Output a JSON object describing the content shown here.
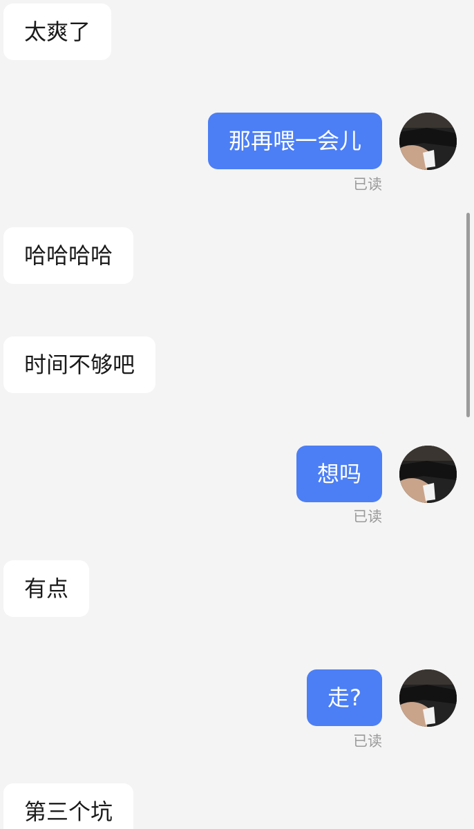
{
  "messages": [
    {
      "side": "in",
      "text": "太爽了"
    },
    {
      "side": "out",
      "text": "那再喂一会儿",
      "read": "已读"
    },
    {
      "side": "in",
      "text": "哈哈哈哈"
    },
    {
      "side": "in",
      "text": "时间不够吧"
    },
    {
      "side": "out",
      "text": "想吗",
      "read": "已读"
    },
    {
      "side": "in",
      "text": "有点"
    },
    {
      "side": "out",
      "text": "走?",
      "read": "已读"
    },
    {
      "side": "in",
      "text": "第三个坑"
    }
  ],
  "colors": {
    "background": "#f4f4f4",
    "incoming_bubble": "#ffffff",
    "outgoing_bubble": "#4c7ff5",
    "read_receipt": "#9a9a9a"
  },
  "icons": {
    "avatar": "user-avatar-photo"
  }
}
